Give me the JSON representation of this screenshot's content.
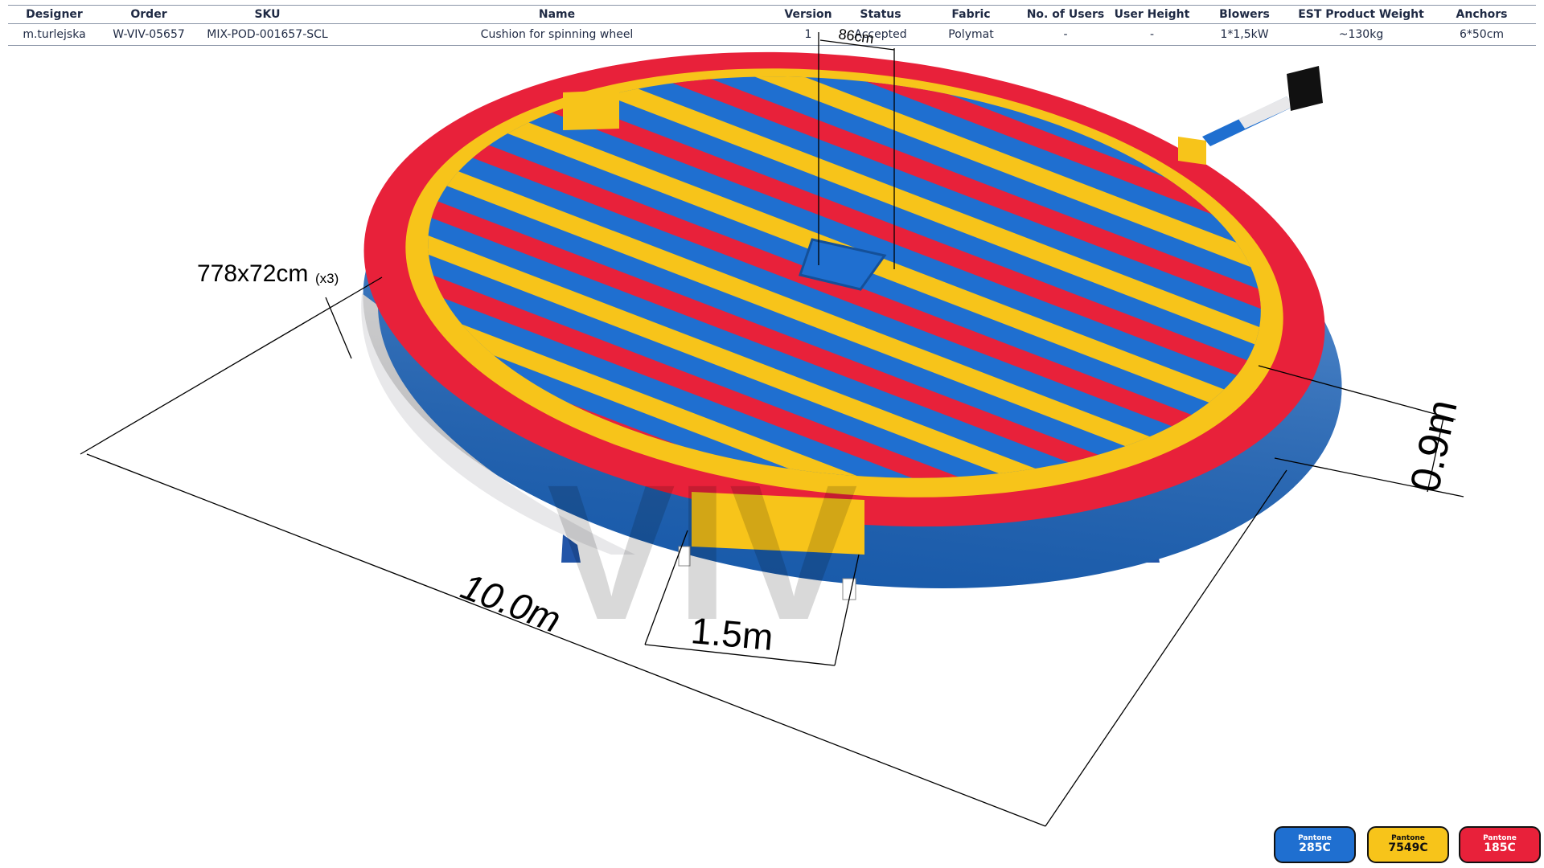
{
  "spec_table": {
    "headers": [
      "Designer",
      "Order",
      "SKU",
      "Name",
      "Version",
      "Status",
      "Fabric",
      "No. of Users",
      "User  Height",
      "Blowers",
      "EST Product Weight",
      "Anchors"
    ],
    "row": [
      "m.turlejska",
      "W-VIV-05657",
      "MIX-POD-001657-SCL",
      "Cushion for spinning wheel",
      "1",
      "Accepted",
      "Polymat",
      "-",
      "-",
      "1*1,5kW",
      "~130kg",
      "6*50cm"
    ]
  },
  "dimensions": {
    "gap_top": "86cm",
    "ring_segment": "778x72cm",
    "ring_segment_count": "(x3)",
    "height": "0.9m",
    "diameter": "10.0m",
    "gap_front": "1.5m"
  },
  "watermark": "VIV",
  "colors": {
    "blue": "#1f6fd0",
    "yellow": "#f7c41a",
    "red": "#e8213a",
    "white_base": "#e8e8ea"
  },
  "pantone_swatches": [
    {
      "brand": "Pantone",
      "code": "285C",
      "color": "#1f6fd0",
      "text_color": "#ffffff"
    },
    {
      "brand": "Pantone",
      "code": "7549C",
      "color": "#f7c41a",
      "text_color": "#111111"
    },
    {
      "brand": "Pantone",
      "code": "185C",
      "color": "#e8213a",
      "text_color": "#ffffff"
    }
  ]
}
